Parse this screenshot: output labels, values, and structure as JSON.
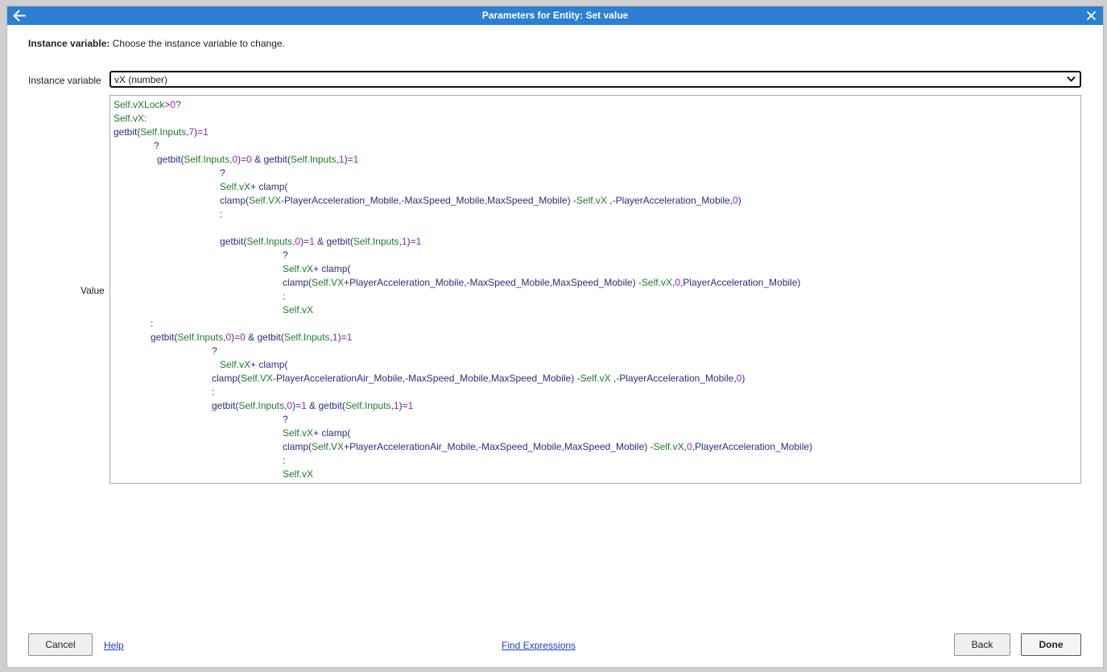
{
  "dialog": {
    "title": "Parameters for Entity: Set value"
  },
  "param": {
    "name": "Instance variable:",
    "description": "Choose the instance variable to change."
  },
  "fields": {
    "instance_variable_label": "Instance variable",
    "instance_variable_value": "vX (number)",
    "value_label": "Value"
  },
  "code": {
    "lines": [
      [
        [
          "Self",
          "obj"
        ],
        [
          ".vXLock",
          "obj"
        ],
        [
          ">",
          "op"
        ],
        [
          "0",
          "num"
        ],
        [
          "?",
          "op"
        ]
      ],
      [
        [
          "Self",
          "obj"
        ],
        [
          ".vX",
          "obj"
        ],
        [
          ":",
          "op"
        ]
      ],
      [
        [
          "getbit(",
          "fn"
        ],
        [
          "Self",
          "obj"
        ],
        [
          ".Inputs",
          "obj"
        ],
        [
          ",",
          "fn"
        ],
        [
          "7",
          "num"
        ],
        [
          ")",
          "fn"
        ],
        [
          "=",
          "op"
        ],
        [
          "1",
          "num"
        ]
      ],
      [
        [
          "?",
          "fn"
        ]
      ],
      [
        [
          "getbit(",
          "fn"
        ],
        [
          "Self",
          "obj"
        ],
        [
          ".Inputs",
          "obj"
        ],
        [
          ",",
          "fn"
        ],
        [
          "0",
          "num"
        ],
        [
          ")",
          "fn"
        ],
        [
          "=",
          "op"
        ],
        [
          "0",
          "num"
        ],
        [
          " & getbit(",
          "fn"
        ],
        [
          "Self",
          "obj"
        ],
        [
          ".Inputs",
          "obj"
        ],
        [
          ",",
          "fn"
        ],
        [
          "1",
          "num"
        ],
        [
          ")",
          "fn"
        ],
        [
          "=",
          "op"
        ],
        [
          "1",
          "num"
        ]
      ],
      [
        [
          "?",
          "fn"
        ]
      ],
      [
        [
          "Self",
          "obj"
        ],
        [
          ".vX",
          "obj"
        ],
        [
          "+ clamp(",
          "fn"
        ]
      ],
      [
        [
          "clamp(",
          "fn"
        ],
        [
          "Self",
          "obj"
        ],
        [
          ".VX",
          "obj"
        ],
        [
          "-PlayerAcceleration_Mobile,-MaxSpeed_Mobile,MaxSpeed_Mobile) -",
          "fn"
        ],
        [
          "Self",
          "obj"
        ],
        [
          ".vX",
          "obj"
        ],
        [
          " ,-PlayerAcceleration_Mobile,",
          "fn"
        ],
        [
          "0",
          "num"
        ],
        [
          ")",
          "fn"
        ]
      ],
      [
        [
          ":",
          "fn"
        ]
      ],
      [
        [
          "",
          "fn"
        ]
      ],
      [
        [
          "getbit(",
          "fn"
        ],
        [
          "Self",
          "obj"
        ],
        [
          ".Inputs",
          "obj"
        ],
        [
          ",",
          "fn"
        ],
        [
          "0",
          "num"
        ],
        [
          ")",
          "fn"
        ],
        [
          "=",
          "op"
        ],
        [
          "1",
          "num"
        ],
        [
          " & getbit(",
          "fn"
        ],
        [
          "Self",
          "obj"
        ],
        [
          ".Inputs",
          "obj"
        ],
        [
          ",",
          "fn"
        ],
        [
          "1",
          "num"
        ],
        [
          ")",
          "fn"
        ],
        [
          "=",
          "op"
        ],
        [
          "1",
          "num"
        ]
      ],
      [
        [
          "?",
          "fn"
        ]
      ],
      [
        [
          "Self",
          "obj"
        ],
        [
          ".vX",
          "obj"
        ],
        [
          "+ clamp(",
          "fn"
        ]
      ],
      [
        [
          "clamp(",
          "fn"
        ],
        [
          "Self",
          "obj"
        ],
        [
          ".VX",
          "obj"
        ],
        [
          "+PlayerAcceleration_Mobile,-MaxSpeed_Mobile,MaxSpeed_Mobile) -",
          "fn"
        ],
        [
          "Self",
          "obj"
        ],
        [
          ".vX",
          "obj"
        ],
        [
          ",",
          "fn"
        ],
        [
          "0",
          "num"
        ],
        [
          ",PlayerAcceleration_Mobile)",
          "fn"
        ]
      ],
      [
        [
          ":",
          "fn"
        ]
      ],
      [
        [
          "Self",
          "obj"
        ],
        [
          ".vX",
          "obj"
        ]
      ],
      [
        [
          ":",
          "fn"
        ]
      ],
      [
        [
          "getbit(",
          "fn"
        ],
        [
          "Self",
          "obj"
        ],
        [
          ".Inputs",
          "obj"
        ],
        [
          ",",
          "fn"
        ],
        [
          "0",
          "num"
        ],
        [
          ")",
          "fn"
        ],
        [
          "=",
          "op"
        ],
        [
          "0",
          "num"
        ],
        [
          " & getbit(",
          "fn"
        ],
        [
          "Self",
          "obj"
        ],
        [
          ".Inputs",
          "obj"
        ],
        [
          ",",
          "fn"
        ],
        [
          "1",
          "num"
        ],
        [
          ")",
          "fn"
        ],
        [
          "=",
          "op"
        ],
        [
          "1",
          "num"
        ]
      ],
      [
        [
          "?",
          "fn"
        ]
      ],
      [
        [
          "Self",
          "obj"
        ],
        [
          ".vX",
          "obj"
        ],
        [
          "+ clamp(",
          "fn"
        ]
      ],
      [
        [
          "clamp(",
          "fn"
        ],
        [
          "Self",
          "obj"
        ],
        [
          ".VX",
          "obj"
        ],
        [
          "-PlayerAccelerationAir_Mobile,-MaxSpeed_Mobile,MaxSpeed_Mobile) -",
          "fn"
        ],
        [
          "Self",
          "obj"
        ],
        [
          ".vX",
          "obj"
        ],
        [
          " ,-PlayerAcceleration_Mobile,",
          "fn"
        ],
        [
          "0",
          "num"
        ],
        [
          ")",
          "fn"
        ]
      ],
      [
        [
          ":",
          "fn"
        ]
      ],
      [
        [
          "getbit(",
          "fn"
        ],
        [
          "Self",
          "obj"
        ],
        [
          ".Inputs",
          "obj"
        ],
        [
          ",",
          "fn"
        ],
        [
          "0",
          "num"
        ],
        [
          ")",
          "fn"
        ],
        [
          "=",
          "op"
        ],
        [
          "1",
          "num"
        ],
        [
          " & getbit(",
          "fn"
        ],
        [
          "Self",
          "obj"
        ],
        [
          ".Inputs",
          "obj"
        ],
        [
          ",",
          "fn"
        ],
        [
          "1",
          "num"
        ],
        [
          ")",
          "fn"
        ],
        [
          "=",
          "op"
        ],
        [
          "1",
          "num"
        ]
      ],
      [
        [
          "?",
          "fn"
        ]
      ],
      [
        [
          "Self",
          "obj"
        ],
        [
          ".vX",
          "obj"
        ],
        [
          "+ clamp(",
          "fn"
        ]
      ],
      [
        [
          "clamp(",
          "fn"
        ],
        [
          "Self",
          "obj"
        ],
        [
          ".VX",
          "obj"
        ],
        [
          "+PlayerAccelerationAir_Mobile,-MaxSpeed_Mobile,MaxSpeed_Mobile) -",
          "fn"
        ],
        [
          "Self",
          "obj"
        ],
        [
          ".vX",
          "obj"
        ],
        [
          ",",
          "fn"
        ],
        [
          "0",
          "num"
        ],
        [
          ",PlayerAcceleration_Mobile)",
          "fn"
        ]
      ],
      [
        [
          ":",
          "fn"
        ]
      ],
      [
        [
          "Self",
          "obj"
        ],
        [
          ".vX",
          "obj"
        ]
      ]
    ]
  },
  "footer": {
    "cancel_label": "Cancel",
    "help_label": "Help",
    "find_expressions_label": "Find Expressions",
    "back_label": "Back",
    "done_label": "Done"
  },
  "colors": {
    "titlebar": "#2c7fd1",
    "object_token": "#1f7a2a",
    "number_token": "#a020c0",
    "function_token": "#2a2e7a"
  }
}
